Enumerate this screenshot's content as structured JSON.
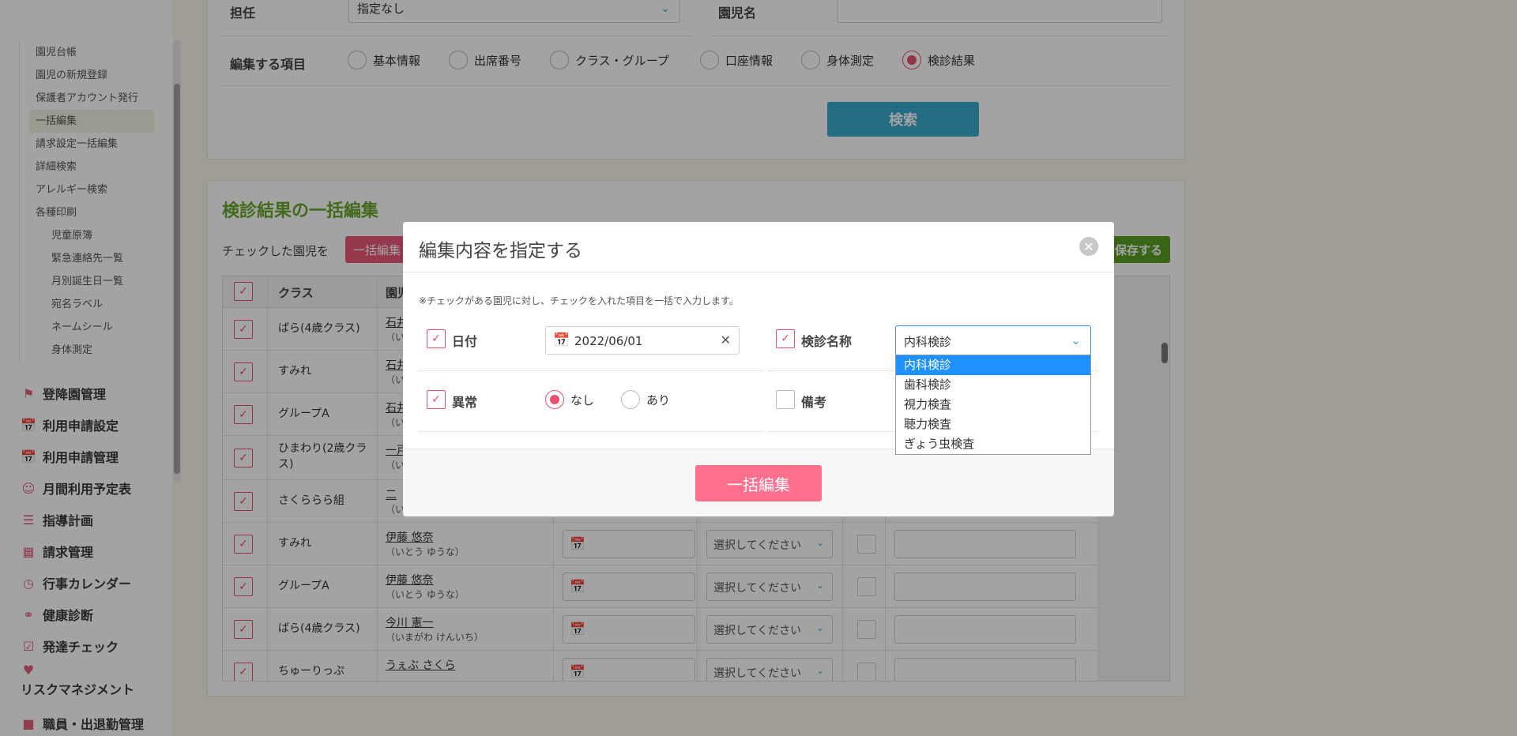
{
  "sidebar": {
    "sub_items": [
      "園児台帳",
      "園児の新規登録",
      "保護者アカウント発行",
      "一括編集",
      "請求設定一括編集",
      "詳細検索",
      "アレルギー検索",
      "各種印刷"
    ],
    "print_items": [
      "児童原簿",
      "緊急連絡先一覧",
      "月別誕生日一覧",
      "宛名ラベル",
      "ネームシール",
      "身体測定"
    ],
    "menu": [
      {
        "label": "登降園管理",
        "icon": "attendance-icon"
      },
      {
        "label": "利用申請設定",
        "icon": "calendar-icon"
      },
      {
        "label": "利用申請管理",
        "icon": "calendar-icon"
      },
      {
        "label": "月間利用予定表",
        "icon": "child-icon"
      },
      {
        "label": "指導計画",
        "icon": "document-icon"
      },
      {
        "label": "請求管理",
        "icon": "calculator-icon"
      },
      {
        "label": "行事カレンダー",
        "icon": "calendar-clock-icon"
      },
      {
        "label": "健康診断",
        "icon": "stethoscope-icon"
      },
      {
        "label": "発達チェック",
        "icon": "checklist-icon"
      },
      {
        "label": "リスクマネジメント",
        "icon": "hands-heart-icon"
      },
      {
        "label": "職員・出退勤管理",
        "icon": "briefcase-icon"
      }
    ]
  },
  "search": {
    "teacher_label": "担任",
    "teacher_value": "指定なし",
    "child_name_label": "園児名",
    "child_name_value": "",
    "edit_items_label": "編集する項目",
    "edit_items": [
      "基本情報",
      "出席番号",
      "クラス・グループ",
      "口座情報",
      "身体測定",
      "検診結果"
    ],
    "selected_edit_item": "検診結果",
    "search_button": "検索"
  },
  "results": {
    "title": "検診結果の一括編集",
    "checked_label": "チェックした園児を",
    "bulk_edit_button": "一括編集",
    "save_button": "保存する",
    "headers": {
      "class": "クラス",
      "child": "園児"
    },
    "select_placeholder": "選択してください",
    "rows": [
      {
        "class": "ばら(4歳クラス)",
        "name": "石井",
        "kana": "（い"
      },
      {
        "class": "すみれ",
        "name": "石井",
        "kana": "（い"
      },
      {
        "class": "グループA",
        "name": "石井",
        "kana": "（い"
      },
      {
        "class": "ひまわり(2歳クラス)",
        "name": "一戸",
        "kana": "（い"
      },
      {
        "class": "さくららら組",
        "name": "二",
        "kana": "（い"
      },
      {
        "class": "すみれ",
        "name": "伊藤 悠奈",
        "kana": "（いとう ゆうな）"
      },
      {
        "class": "グループA",
        "name": "伊藤 悠奈",
        "kana": "（いとう ゆうな）"
      },
      {
        "class": "ばら(4歳クラス)",
        "name": "今川 憲一",
        "kana": "（いまがわ けんいち）"
      },
      {
        "class": "ちゅーりっぷ",
        "name": "うぇぶ さくら",
        "kana": ""
      }
    ]
  },
  "modal": {
    "title": "編集内容を指定する",
    "note": "※チェックがある園児に対し、チェックを入れた項目を一括で入力します。",
    "date_label": "日付",
    "date_value": "2022/06/01",
    "exam_name_label": "検診名称",
    "exam_name_value": "内科検診",
    "abnormal_label": "異常",
    "abnormal_options": [
      "なし",
      "あり"
    ],
    "abnormal_selected": "なし",
    "remarks_label": "備考",
    "dropdown_options": [
      "内科検診",
      "歯科検診",
      "視力検査",
      "聴力検査",
      "ぎょう虫検査"
    ],
    "dropdown_selected": "内科検診",
    "bulk_edit_button": "一括編集"
  },
  "colors": {
    "accent_pink": "#e5506e",
    "accent_blue": "#39a9cc",
    "accent_green": "#6aa62c",
    "dropdown_highlight": "#1e90ff"
  }
}
